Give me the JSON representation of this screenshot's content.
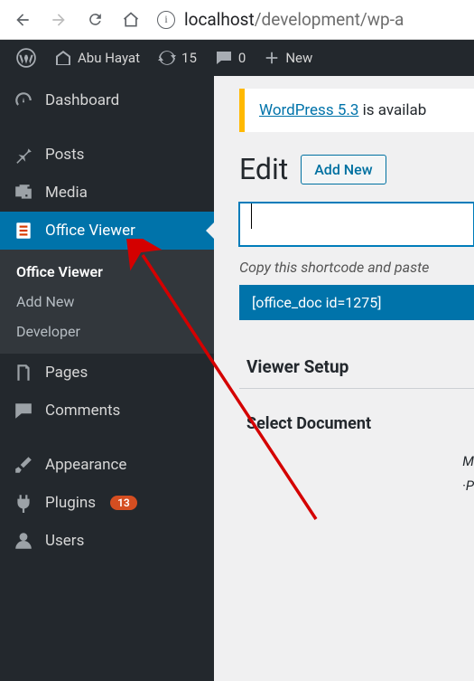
{
  "browser": {
    "url_host": "localhost",
    "url_path": "/development/wp-a"
  },
  "adminbar": {
    "site_name": "Abu Hayat",
    "updates": "15",
    "comments": "0",
    "new_label": "New"
  },
  "sidebar": {
    "dashboard": "Dashboard",
    "posts": "Posts",
    "media": "Media",
    "office_viewer": "Office Viewer",
    "sub_office_viewer": "Office Viewer",
    "sub_add_new": "Add New",
    "sub_developer": "Developer",
    "pages": "Pages",
    "comments": "Comments",
    "appearance": "Appearance",
    "plugins": "Plugins",
    "plugins_badge": "13",
    "users": "Users"
  },
  "content": {
    "notice_link": "WordPress 5.3",
    "notice_text": " is availab",
    "title": "Edit",
    "add_new": "Add New",
    "helper": "Copy this shortcode and paste",
    "shortcode": "[office_doc id=1275]",
    "panel_title": "Viewer Setup",
    "field_label": "Select Document",
    "hint_line1": "M",
    "hint_line2": "·P"
  }
}
